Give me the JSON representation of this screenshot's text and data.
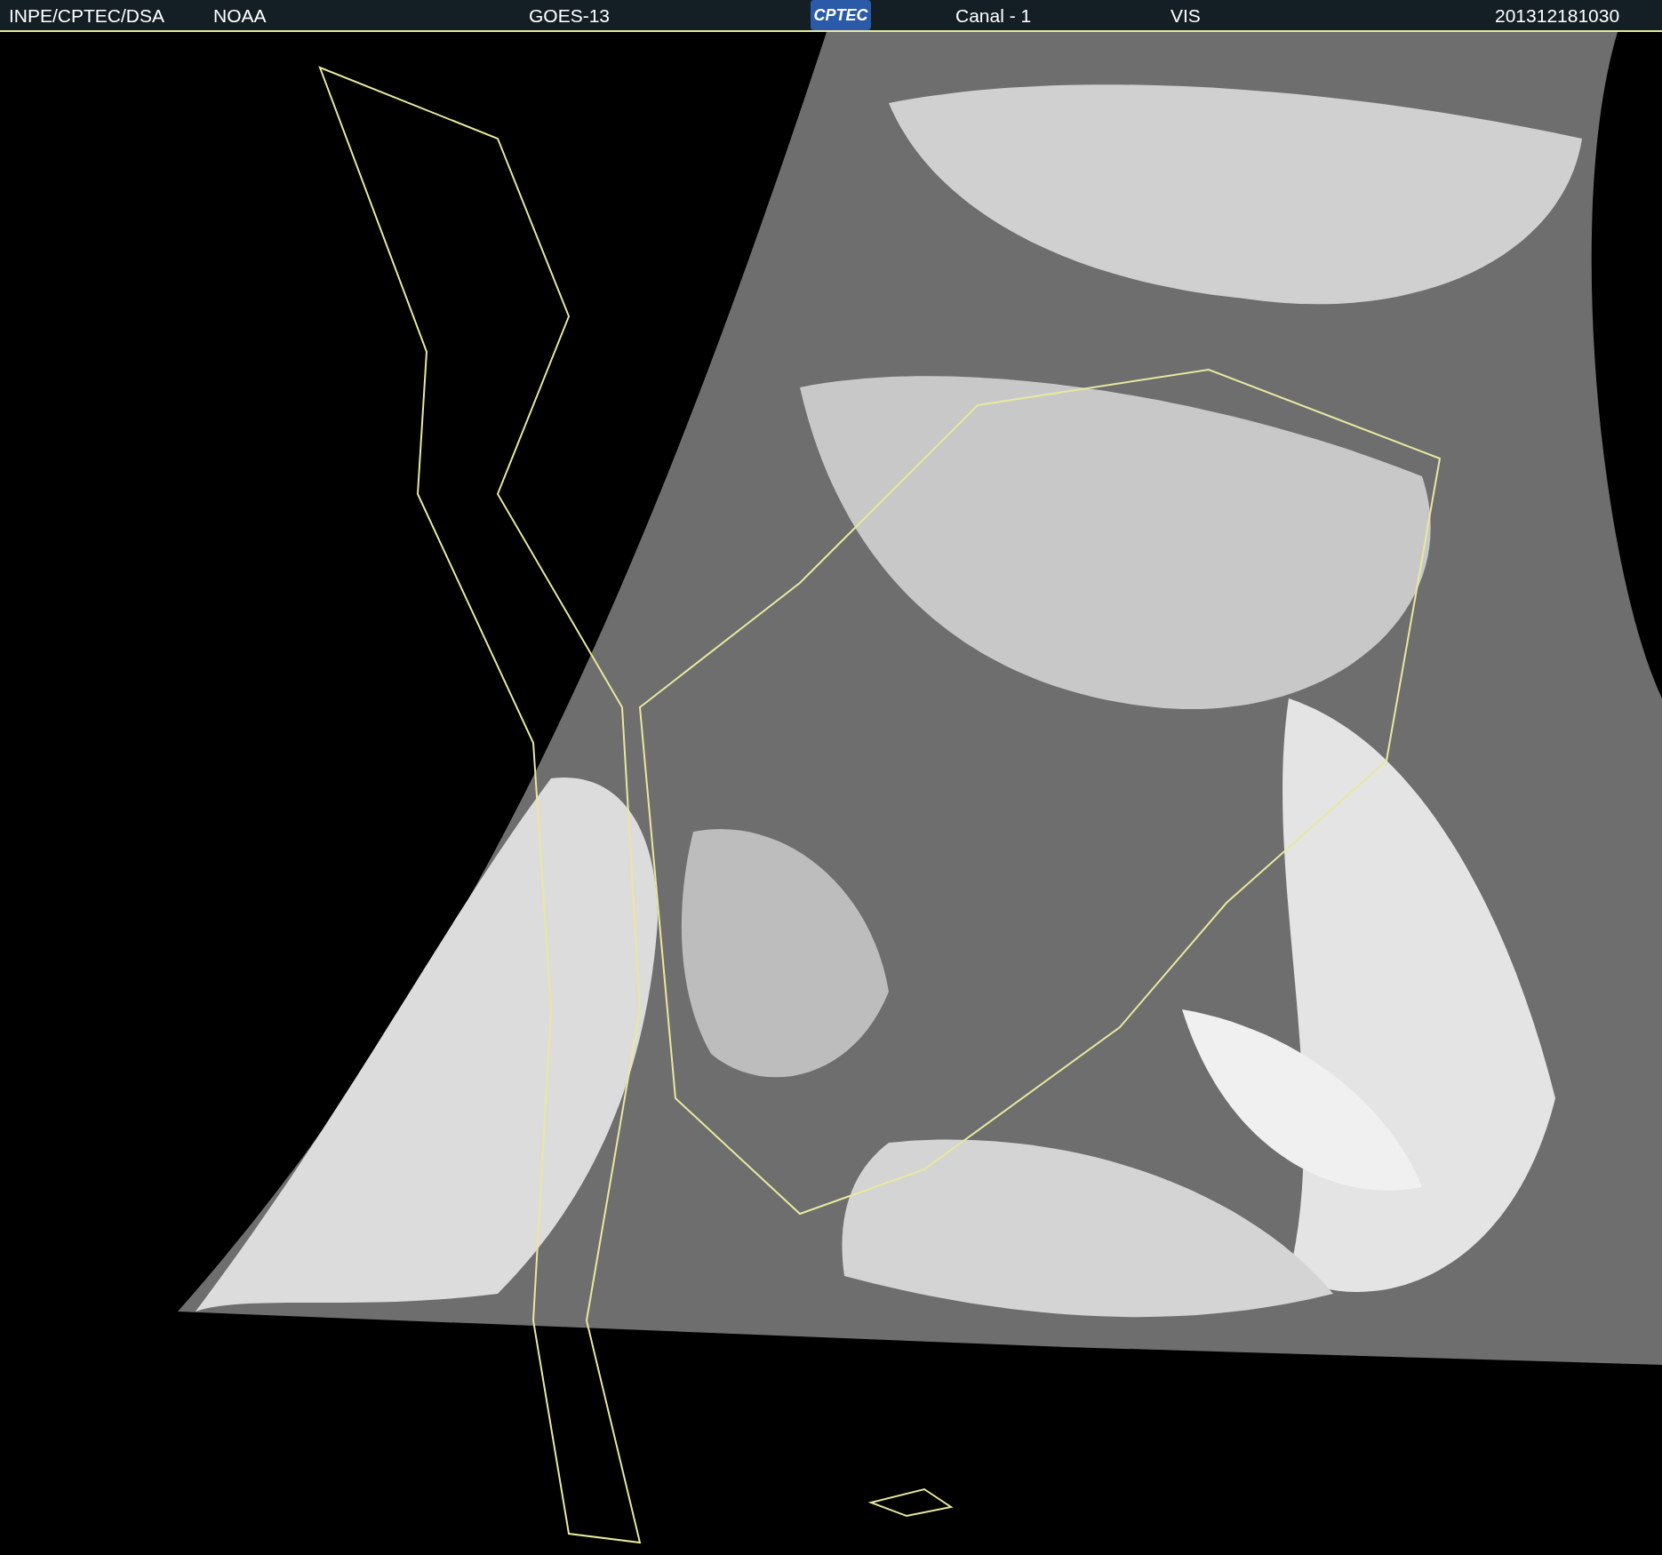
{
  "header": {
    "source": "INPE/CPTEC/DSA",
    "agency": "NOAA",
    "satellite": "GOES-13",
    "logo": "CPTEC",
    "channel": "Canal - 1",
    "band": "VIS",
    "timestamp": "201312181030"
  }
}
